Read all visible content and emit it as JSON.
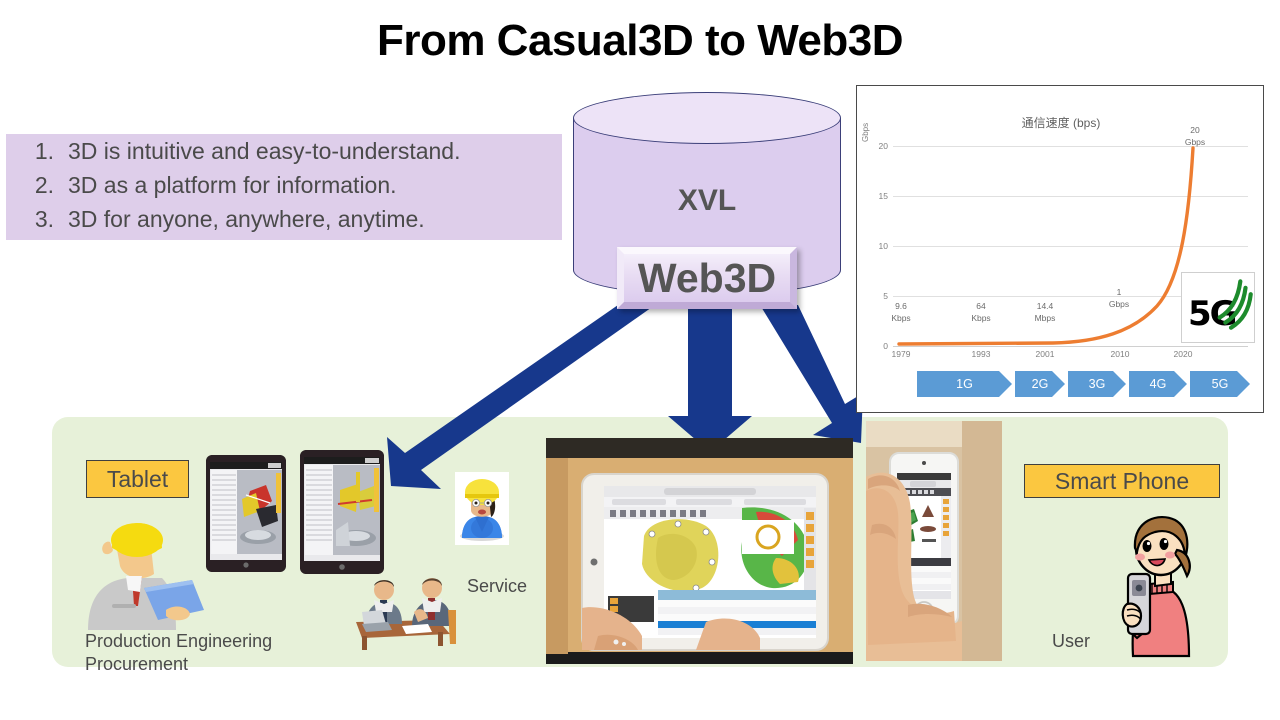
{
  "slide": {
    "title": "From Casual3D to Web3D",
    "background": "#ffffff"
  },
  "bullets": {
    "background_color": "#DECEEA",
    "items": [
      {
        "number": "1.",
        "text": "3D is intuitive and easy-to-understand."
      },
      {
        "number": "2.",
        "text": "3D as a platform for information."
      },
      {
        "number": "3.",
        "text": "3D for anyone, anywhere, anytime."
      }
    ]
  },
  "cylinder": {
    "label": "XVL",
    "fill_color": "#DCCDEE",
    "outline_color": "#3b3f79"
  },
  "web3d_plate": {
    "label": "Web3D",
    "text_color": "#555555"
  },
  "arrows": {
    "color": "#17388C",
    "count": 3,
    "directions": [
      "down-left",
      "down",
      "down-right"
    ]
  },
  "chart_data": {
    "type": "line",
    "title": "通信速度 (bps)",
    "xlabel": "",
    "ylabel": "Gbps",
    "ylim": [
      0,
      22
    ],
    "yticks": [
      0,
      5,
      10,
      15,
      20
    ],
    "xlim": [
      1979,
      2022
    ],
    "xticks": [
      "1979",
      "1993",
      "2001",
      "2010",
      "2020"
    ],
    "grid": true,
    "legend": "none",
    "line_color": "#ED7D31",
    "x": [
      1979,
      1993,
      2001,
      2010,
      2020
    ],
    "values": [
      9.6e-06,
      6.4e-05,
      0.0144,
      1,
      20
    ],
    "point_labels": [
      {
        "x": "1979",
        "value": "9.6",
        "unit": "Kbps"
      },
      {
        "x": "1993",
        "value": "64",
        "unit": "Kbps"
      },
      {
        "x": "2001",
        "value": "14.4",
        "unit": "Mbps"
      },
      {
        "x": "2010",
        "value": "1",
        "unit": "Gbps"
      },
      {
        "x": "2020",
        "value": "20",
        "unit": "Gbps"
      }
    ],
    "generations": [
      "1G",
      "2G",
      "3G",
      "4G",
      "5G"
    ],
    "generation_color": "#5B9BD5",
    "logo": {
      "text": "5G",
      "arc_color": "#1D8B2C"
    }
  },
  "bottom_panel": {
    "background_color": "#E7F1D9",
    "badges": [
      {
        "name": "tablet",
        "label": "Tablet"
      },
      {
        "name": "smart-phone",
        "label": "Smart Phone"
      }
    ],
    "captions": [
      {
        "name": "production-engineering",
        "line1": "Production Engineering",
        "line2": "Procurement"
      },
      {
        "name": "service",
        "label": "Service"
      },
      {
        "name": "user",
        "label": "User"
      }
    ],
    "badge_color": "#FBC740"
  }
}
